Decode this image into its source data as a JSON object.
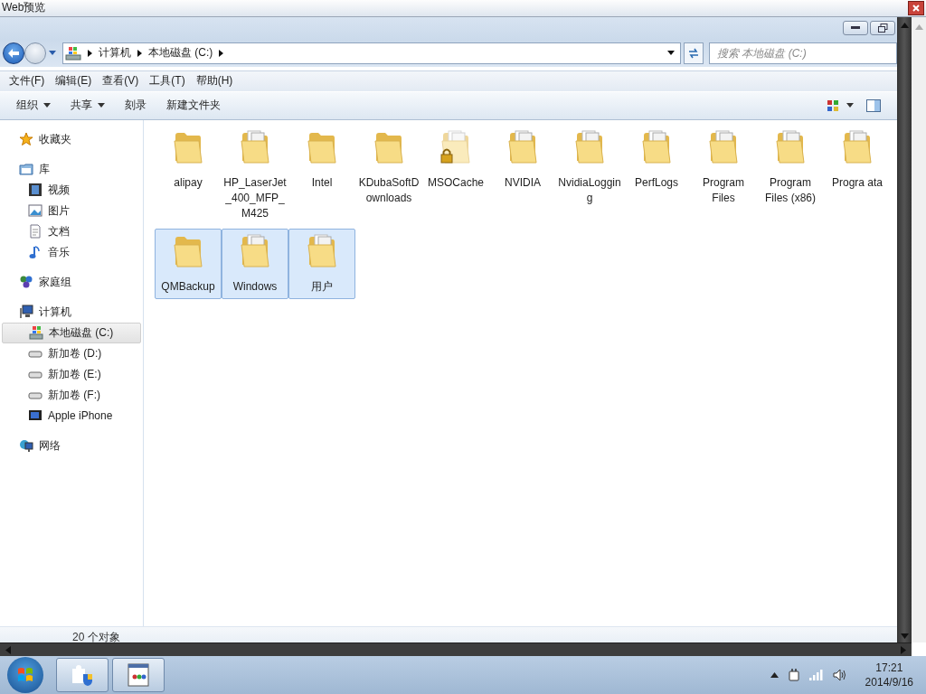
{
  "app_title": "Web预览",
  "breadcrumb": [
    "计算机",
    "本地磁盘 (C:)"
  ],
  "search": {
    "placeholder": "搜索 本地磁盘 (C:)"
  },
  "menu": [
    "文件(F)",
    "编辑(E)",
    "查看(V)",
    "工具(T)",
    "帮助(H)"
  ],
  "toolbar": [
    {
      "label": "组织",
      "dropdown": true
    },
    {
      "label": "共享",
      "dropdown": true
    },
    {
      "label": "刻录",
      "dropdown": false
    },
    {
      "label": "新建文件夹",
      "dropdown": false
    }
  ],
  "sidebar": [
    {
      "label": "收藏夹",
      "kind": "star",
      "selected": false
    },
    {
      "label": "库",
      "kind": "library",
      "selected": false,
      "children": [
        {
          "label": "视频",
          "kind": "video",
          "selected": false
        },
        {
          "label": "图片",
          "kind": "picture",
          "selected": false
        },
        {
          "label": "文档",
          "kind": "document",
          "selected": false
        },
        {
          "label": "音乐",
          "kind": "music",
          "selected": false
        }
      ]
    },
    {
      "label": "家庭组",
      "kind": "homegroup",
      "selected": false
    },
    {
      "label": "计算机",
      "kind": "computer",
      "selected": false,
      "children": [
        {
          "label": "本地磁盘 (C:)",
          "kind": "sysdrive",
          "selected": true
        },
        {
          "label": "新加卷 (D:)",
          "kind": "drive",
          "selected": false
        },
        {
          "label": "新加卷 (E:)",
          "kind": "drive",
          "selected": false
        },
        {
          "label": "新加卷 (F:)",
          "kind": "drive",
          "selected": false
        },
        {
          "label": "Apple iPhone",
          "kind": "phone",
          "selected": false
        }
      ]
    },
    {
      "label": "网络",
      "kind": "network",
      "selected": false
    }
  ],
  "folders": [
    {
      "label": "alipay",
      "kind": "plain",
      "selected": false
    },
    {
      "label": "HP_LaserJet_400_MFP_M425",
      "kind": "documents",
      "selected": false
    },
    {
      "label": "Intel",
      "kind": "plain",
      "selected": false
    },
    {
      "label": "KDubaSoftDownloads",
      "kind": "plain",
      "selected": false
    },
    {
      "label": "MSOCache",
      "kind": "locked",
      "selected": false
    },
    {
      "label": "NVIDIA",
      "kind": "documents",
      "selected": false
    },
    {
      "label": "NvidiaLogging",
      "kind": "documents",
      "selected": false
    },
    {
      "label": "PerfLogs",
      "kind": "documents",
      "selected": false
    },
    {
      "label": "Program Files",
      "kind": "documents",
      "selected": false
    },
    {
      "label": "Program Files (x86)",
      "kind": "documents",
      "selected": false
    },
    {
      "label": "Progra ata",
      "kind": "documents",
      "selected": false
    },
    {
      "label": "QMBackup",
      "kind": "plain",
      "selected": true
    },
    {
      "label": "Windows",
      "kind": "documents",
      "selected": true
    },
    {
      "label": "用户",
      "kind": "documents",
      "selected": true
    }
  ],
  "status_bar": "20 个对象",
  "clock": {
    "time": "17:21",
    "date": "2014/9/16"
  }
}
